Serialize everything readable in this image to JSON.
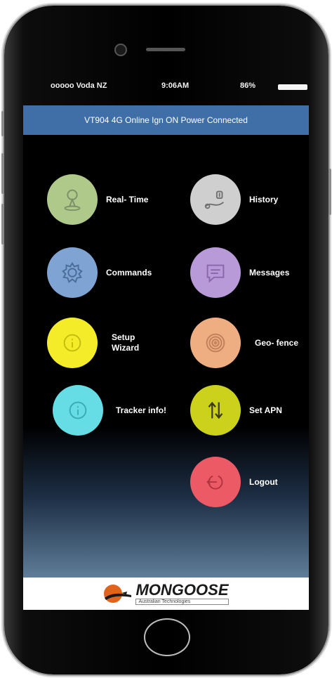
{
  "status_bar": {
    "carrier": "ooooo Voda NZ",
    "time": "9:06AM",
    "battery": "86%"
  },
  "banner": {
    "text": "VT904 4G Online Ign ON Power Connected",
    "color": "#3f6fa6"
  },
  "menu": [
    {
      "label": "Real- Time",
      "icon": "person-pin-icon",
      "color": "#aec98a"
    },
    {
      "label": "History",
      "icon": "route-dollar-icon",
      "color": "#cfcfcf"
    },
    {
      "label": "Commands",
      "icon": "gear-icon",
      "color": "#7fa3d3"
    },
    {
      "label": "Messages",
      "icon": "message-icon",
      "color": "#b99ad8"
    },
    {
      "label": "Setup\nWizard",
      "icon": "info-circle-icon",
      "color": "#f4ec28"
    },
    {
      "label": "Geo- fence",
      "icon": "target-icon",
      "color": "#eeae82"
    },
    {
      "label": "Tracker info!",
      "icon": "info-circle-icon",
      "color": "#66dce5"
    },
    {
      "label": "Set APN",
      "icon": "transfer-arrows-icon",
      "color": "#ccd21c"
    },
    {
      "label": "Logout",
      "icon": "logout-icon",
      "color": "#ec5a66"
    }
  ],
  "logo": {
    "name": "MONGOOSE",
    "tagline": "Australian Technologies"
  }
}
